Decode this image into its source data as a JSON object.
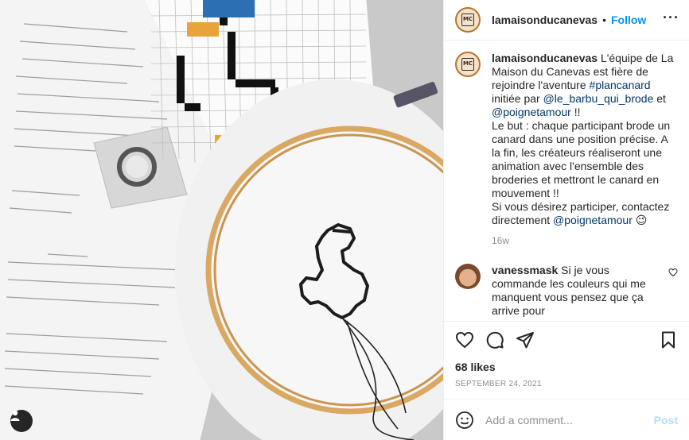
{
  "post": {
    "username": "lamaisonducanevas",
    "separator": "•",
    "follow_label": "Follow",
    "more_label": "···",
    "caption_user": "lamaisonducanevas",
    "caption_parts": [
      {
        "t": "text",
        "v": " L'équipe de La Maison du Canevas est fière de rejoindre l'aventure "
      },
      {
        "t": "tag",
        "v": "#plancanard"
      },
      {
        "t": "text",
        "v": " initiée par "
      },
      {
        "t": "tag",
        "v": "@le_barbu_qui_brode"
      },
      {
        "t": "text",
        "v": " et "
      },
      {
        "t": "tag",
        "v": "@poignetamour"
      },
      {
        "t": "text",
        "v": " !!"
      }
    ],
    "caption_line2": "Le but : chaque participant brode un canard dans une position précise. A la fin, les créateurs réaliseront une animation avec l'ensemble des broderies et mettront le canard en mouvement !!",
    "caption_line3_text": "Si vous désirez participer, contactez directement ",
    "caption_line3_tag": "@poignetamour",
    "caption_line3_emoji": "😉",
    "time_ago": "16w",
    "comment": {
      "username": "vanessmask",
      "text": " Si je vous commande les couleurs qui me manquent vous pensez que ça arrive pour"
    },
    "likes": "68 likes",
    "date": "SEPTEMBER 24, 2021",
    "add_comment_placeholder": "Add a comment...",
    "post_label": "Post"
  },
  "icons": {
    "like": "heart-icon",
    "comment": "comment-icon",
    "share": "send-icon",
    "save": "bookmark-icon",
    "emoji": "emoji-icon",
    "user_tag": "user-icon"
  },
  "colors": {
    "link": "#00376b",
    "follow": "#0095f6",
    "muted": "#8e8e8e",
    "post_disabled": "#b2dffc"
  }
}
